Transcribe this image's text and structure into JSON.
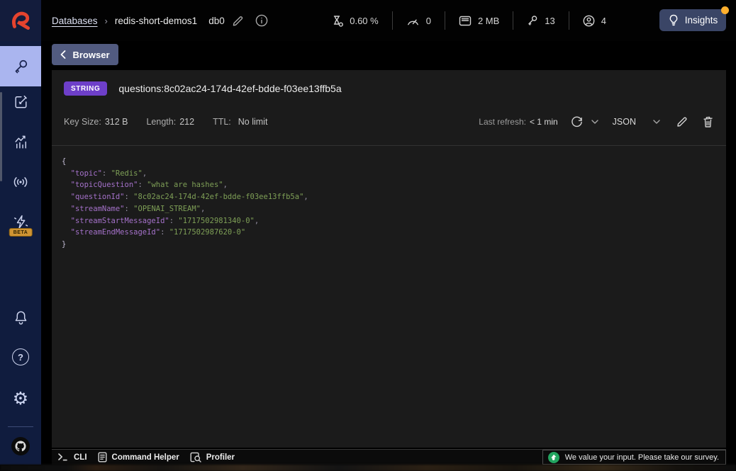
{
  "top_bar": {
    "breadcrumb": {
      "databases_link": "Databases",
      "separator": "›",
      "database_name": "redis-short-demos1",
      "db_index": "db0"
    },
    "stats": {
      "cpu": "0.60 %",
      "commands_per_sec": "0",
      "memory": "2 MB",
      "total_keys": "13",
      "connected_clients": "4"
    },
    "insights_button_label": "Insights"
  },
  "sidebar": {
    "beta_badge_label": "BETA"
  },
  "browser_panel": {
    "back_button_label": "Browser",
    "key_type_badge": "STRING",
    "key_name": "questions:8c02ac24-174d-42ef-bdde-f03ee13ffb5a",
    "meta": {
      "key_size_label": "Key Size:",
      "key_size_value": "312 B",
      "length_label": "Length:",
      "length_value": "212",
      "ttl_label": "TTL:",
      "ttl_value": "No limit"
    },
    "refresh": {
      "label": "Last refresh:",
      "value": "< 1 min"
    },
    "format_selector_value": "JSON"
  },
  "value_viewer": {
    "open_brace": "{",
    "close_brace": "}",
    "fields": [
      {
        "key": "topic",
        "value": "Redis"
      },
      {
        "key": "topicQuestion",
        "value": "what are hashes"
      },
      {
        "key": "questionId",
        "value": "8c02ac24-174d-42ef-bdde-f03ee13ffb5a"
      },
      {
        "key": "streamName",
        "value": "OPENAI_STREAM"
      },
      {
        "key": "streamStartMessageId",
        "value": "1717502981340-0"
      },
      {
        "key": "streamEndMessageId",
        "value": "1717502987620-0"
      }
    ]
  },
  "bottom_bar": {
    "cli_label": "CLI",
    "command_helper_label": "Command Helper",
    "profiler_label": "Profiler",
    "survey_text": "We value your input. Please take our survey."
  },
  "icons": {
    "gear": "⚙",
    "help": "?"
  },
  "colors": {
    "accent_purple_badge": "#6e3fc9",
    "active_nav_background": "#aab5ef",
    "insights_notification_dot": "#ffb02e",
    "json_key": "#a471c9",
    "json_string": "#7e9f56",
    "beta_badge": "#cf9433",
    "survey_icon_green": "#22a45f",
    "logo_red": "#e5432e",
    "sidebar_background": "#101c3e",
    "panel_background": "#1b1b1b"
  }
}
